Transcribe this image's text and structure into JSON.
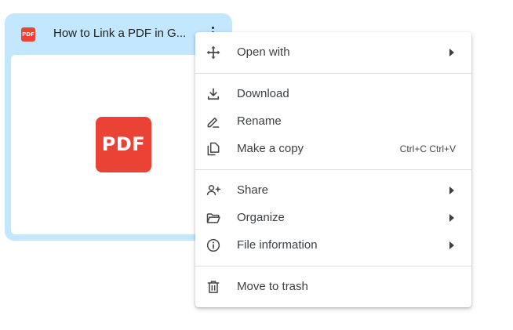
{
  "file_card": {
    "type_badge": "PDF",
    "title": "How to Link a PDF in G...",
    "preview_badge": "PDF"
  },
  "menu": {
    "items": [
      {
        "label": "Open with",
        "icon": "open-with-icon",
        "submenu": true
      },
      {
        "label": "Download",
        "icon": "download-icon"
      },
      {
        "label": "Rename",
        "icon": "rename-icon"
      },
      {
        "label": "Make a copy",
        "icon": "copy-icon",
        "shortcut": "Ctrl+C Ctrl+V"
      },
      {
        "label": "Share",
        "icon": "share-icon",
        "submenu": true
      },
      {
        "label": "Organize",
        "icon": "folder-icon",
        "submenu": true
      },
      {
        "label": "File information",
        "icon": "info-icon",
        "submenu": true
      },
      {
        "label": "Move to trash",
        "icon": "trash-icon"
      }
    ]
  },
  "colors": {
    "card_bg": "#c2e7ff",
    "pdf_red": "#ea4335",
    "menu_text": "#3c4043"
  }
}
